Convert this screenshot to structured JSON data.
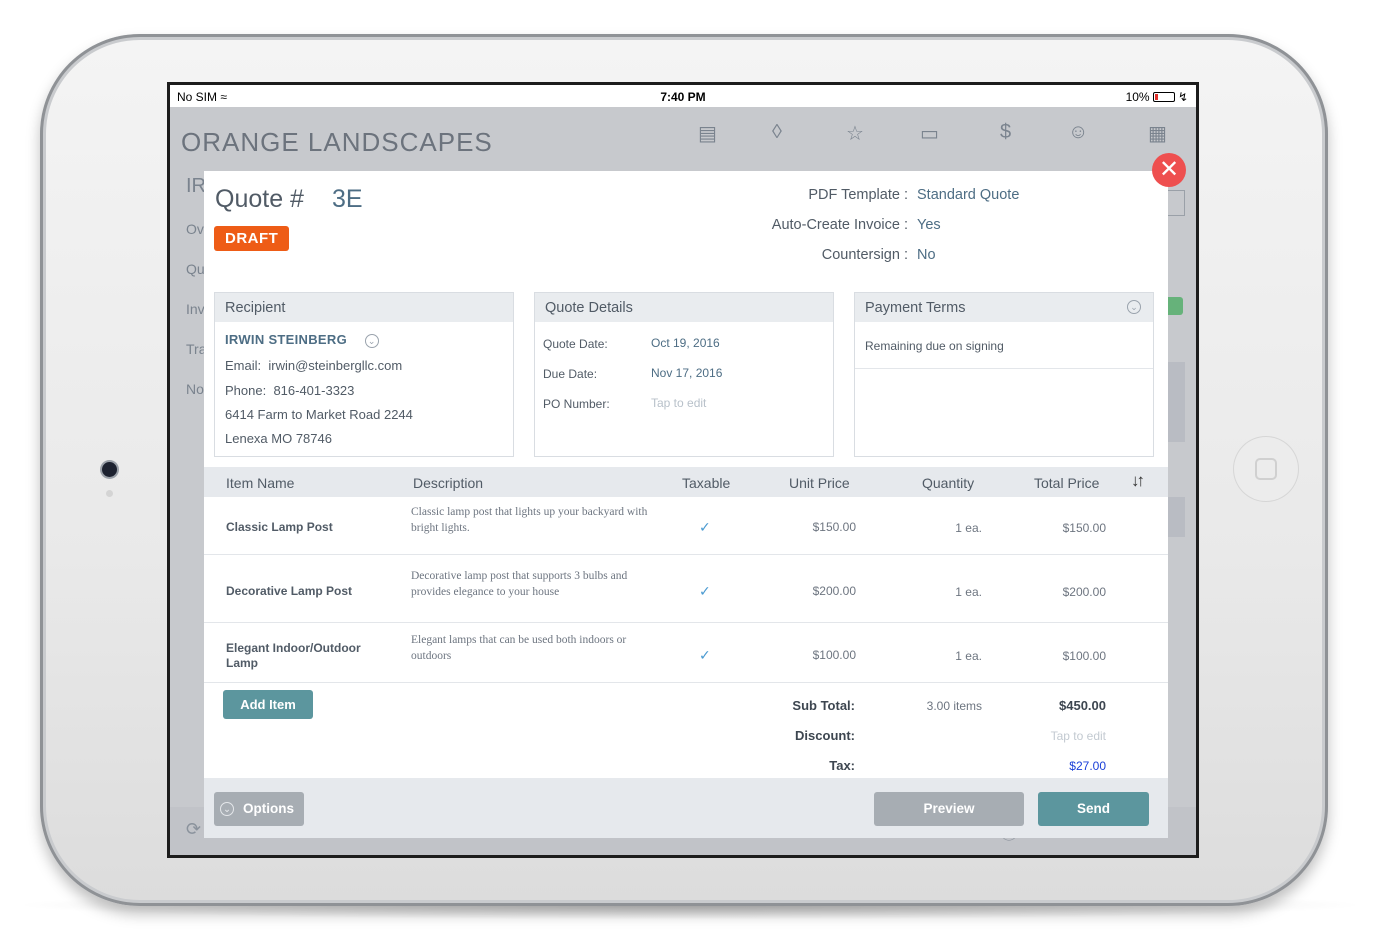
{
  "status_bar": {
    "carrier": "No SIM",
    "time": "7:40 PM",
    "battery": "10%"
  },
  "app": {
    "title": "ORANGE LANDSCAPES",
    "sidebar_fragments": [
      "IR",
      "Ov",
      "Qu",
      "Inv",
      "Tra",
      "No"
    ]
  },
  "quote": {
    "label": "Quote #",
    "number": "3E",
    "status": "DRAFT",
    "meta": [
      {
        "label": "PDF Template :",
        "value": "Standard Quote"
      },
      {
        "label": "Auto-Create Invoice :",
        "value": "Yes"
      },
      {
        "label": "Countersign :",
        "value": "No"
      }
    ]
  },
  "recipient": {
    "title": "Recipient",
    "name": "IRWIN STEINBERG",
    "email_label": "Email:",
    "email": "irwin@steinbergllc.com",
    "phone_label": "Phone:",
    "phone": "816-401-3323",
    "address1": "6414 Farm to Market Road 2244",
    "address2": "Lenexa MO 78746"
  },
  "quote_details": {
    "title": "Quote Details",
    "fields": [
      {
        "label": "Quote Date:",
        "value": "Oct 19, 2016"
      },
      {
        "label": "Due Date:",
        "value": "Nov 17, 2016"
      },
      {
        "label": "PO Number:",
        "value": "Tap to edit"
      }
    ]
  },
  "payment_terms": {
    "title": "Payment Terms",
    "text": "Remaining due on signing"
  },
  "table": {
    "headers": [
      "Item Name",
      "Description",
      "Taxable",
      "Unit Price",
      "Quantity",
      "Total Price"
    ],
    "rows": [
      {
        "name": "Classic Lamp Post",
        "description": "Classic lamp post that lights up your backyard with bright lights.",
        "taxable": "✓",
        "unit_price": "$150.00",
        "quantity": "1 ea.",
        "total": "$150.00"
      },
      {
        "name": "Decorative Lamp Post",
        "description": "Decorative lamp post that supports 3 bulbs and provides elegance to your house",
        "taxable": "✓",
        "unit_price": "$200.00",
        "quantity": "1 ea.",
        "total": "$200.00"
      },
      {
        "name": "Elegant Indoor/Outdoor Lamp",
        "description": "Elegant lamps that can be used both indoors or outdoors",
        "taxable": "✓",
        "unit_price": "$100.00",
        "quantity": "1 ea.",
        "total": "$100.00"
      }
    ]
  },
  "summary": {
    "add_item": "Add Item",
    "subtotal_label": "Sub Total:",
    "item_count": "3.00 items",
    "subtotal": "$450.00",
    "discount_label": "Discount:",
    "discount": "Tap to edit",
    "tax_label": "Tax:",
    "tax": "$27.00"
  },
  "footer": {
    "options": "Options",
    "preview": "Preview",
    "send": "Send"
  },
  "colors": {
    "accent": "#5c969e",
    "draft": "#ee5c16",
    "close": "#ee4f4f",
    "link": "#4d6d84",
    "tax": "#1a3fd8"
  },
  "icons": [
    "briefcase-icon",
    "layers-icon",
    "star-icon",
    "folder-icon",
    "dollar-icon",
    "users-icon",
    "calendar-icon",
    "close-icon",
    "chevron-down-icon",
    "sort-icon",
    "sync-icon",
    "help-icon",
    "cart-icon",
    "gear-icon",
    "lock-icon"
  ]
}
